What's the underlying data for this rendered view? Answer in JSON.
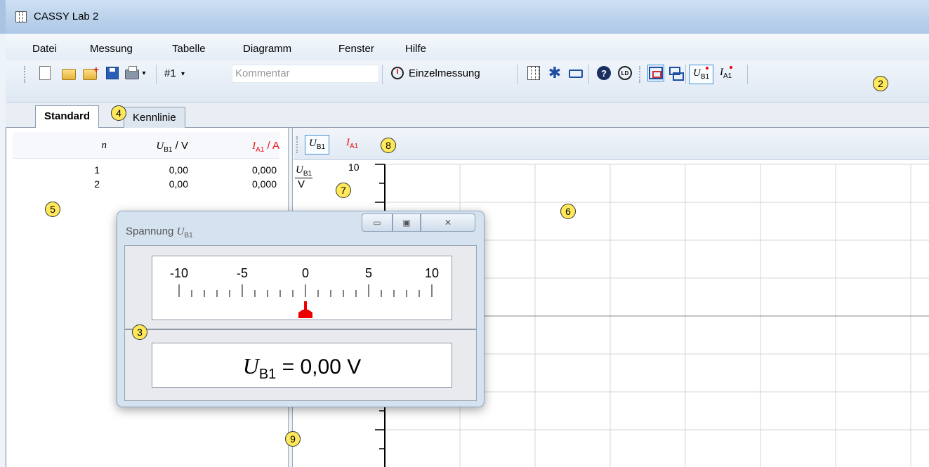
{
  "window": {
    "title": "CASSY Lab 2",
    "icon": "grid-icon"
  },
  "menu": [
    "Datei",
    "Messung",
    "Tabelle",
    "Diagramm",
    "Fenster",
    "Hilfe"
  ],
  "toolbar": {
    "measurement_number": "#1",
    "comment_placeholder": "Kommentar",
    "single_measurement_label": "Einzelmessung",
    "help_label": "?",
    "ld_label": "LD",
    "qty1_symbol": "U",
    "qty1_index": "B1",
    "qty2_symbol": "I",
    "qty2_index": "A1"
  },
  "tabs": [
    "Standard",
    "Kennlinie"
  ],
  "table": {
    "headers": {
      "n": "n",
      "u_symbol": "U",
      "u_index": "B1",
      "u_unit": " / V",
      "i_symbol": "I",
      "i_index": "A1",
      "i_unit": " / A"
    },
    "rows": [
      {
        "n": "1",
        "u": "0,00",
        "i": "0,000"
      },
      {
        "n": "2",
        "u": "0,00",
        "i": "0,000"
      }
    ]
  },
  "diagram": {
    "toolbar_qty1_symbol": "U",
    "toolbar_qty1_index": "B1",
    "toolbar_qty2_symbol": "I",
    "toolbar_qty2_index": "A1",
    "y_label_symbol": "U",
    "y_label_index": "B1",
    "y_label_unit": "V",
    "y_max_tick": "10"
  },
  "meter": {
    "title_text": "Spannung ",
    "title_symbol": "U",
    "title_index": "B1",
    "scale_labels": [
      "-10",
      "-5",
      "0",
      "5",
      "10"
    ],
    "scale_min": -10,
    "scale_max": 10,
    "needle_value": 0,
    "readout_symbol": "U",
    "readout_index": "B1",
    "readout_value": " =  0,00 V"
  },
  "callouts": [
    "2",
    "3",
    "4",
    "5",
    "6",
    "7",
    "8",
    "9"
  ],
  "colors": {
    "accent_red": "#e11111",
    "selection_blue": "#3a8fd6",
    "callout_yellow": "#ffe95a"
  }
}
